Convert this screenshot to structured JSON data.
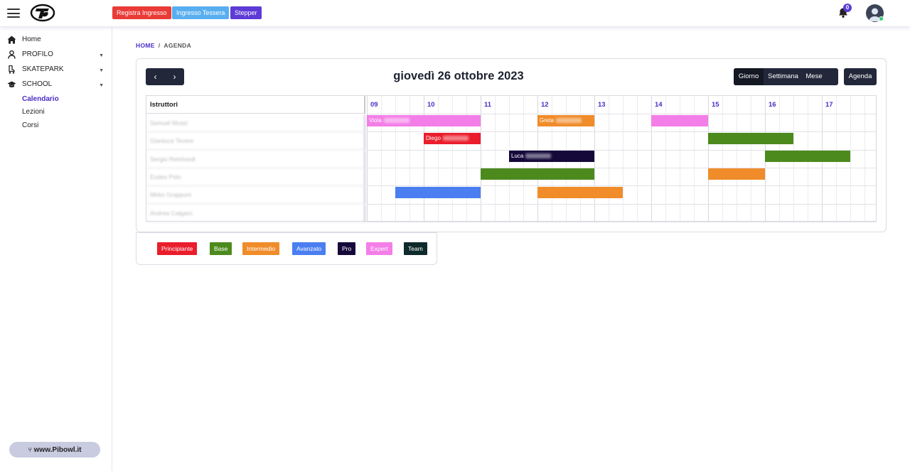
{
  "colors": {
    "accent": "#4b2cc7",
    "principiante": "#ea1d2c",
    "base": "#4c8a1e",
    "intermedio": "#f08c2a",
    "avanzato": "#4a7ef1",
    "pro": "#15093a",
    "expert": "#f47ee8",
    "team": "#0f2a2b",
    "registra_btn": "#ea3b36",
    "tessera_btn": "#59aef0",
    "stepper_btn": "#5c3bd6"
  },
  "topbar": {
    "menu_icon": "hamburger-icon",
    "logo": "pibowl-logo",
    "buttons": [
      "Registra Ingresso",
      "Ingresso Tessera",
      "Stepper"
    ],
    "notifications_count": "0"
  },
  "sidebar": {
    "items": [
      {
        "label": "Home",
        "icon": "home-icon"
      },
      {
        "label": "PROFILO",
        "icon": "user-icon"
      },
      {
        "label": "SKATEPARK",
        "icon": "skate-icon"
      },
      {
        "label": "SCHOOL",
        "icon": "graduation-cap-icon"
      }
    ],
    "school_sub": [
      "Calendario",
      "Lezioni",
      "Corsi"
    ],
    "site_link": "www.Pibowl.it"
  },
  "breadcrumb": {
    "home": "HOME",
    "sep": "/",
    "current": "AGENDA"
  },
  "calendar": {
    "title": "giovedì 26 ottobre 2023",
    "prev": "‹",
    "next": "›",
    "views": [
      "Giorno",
      "Settimana",
      "Mese"
    ],
    "active_view": "Giorno",
    "agenda_label": "Agenda",
    "resource_header": "Istruttori",
    "hours": [
      "09",
      "10",
      "11",
      "12",
      "13",
      "14",
      "15",
      "16",
      "17"
    ],
    "resources": [
      "Samuel Music",
      "Gianluca Tevere",
      "Sergio Reinhardt",
      "Eudes Polo",
      "Mirko Grapponi",
      "Andrea Calgaro"
    ],
    "events": [
      {
        "row": 0,
        "start": 9.0,
        "end": 11.0,
        "level": "expert",
        "label": "Viola"
      },
      {
        "row": 0,
        "start": 12.0,
        "end": 13.0,
        "level": "intermedio",
        "label": "Greta"
      },
      {
        "row": 0,
        "start": 14.0,
        "end": 15.0,
        "level": "expert",
        "label": ""
      },
      {
        "row": 1,
        "start": 10.0,
        "end": 11.0,
        "level": "principiante",
        "label": "Diego"
      },
      {
        "row": 1,
        "start": 15.0,
        "end": 16.5,
        "level": "base",
        "label": ""
      },
      {
        "row": 2,
        "start": 11.5,
        "end": 13.0,
        "level": "pro",
        "label": "Luca"
      },
      {
        "row": 2,
        "start": 16.0,
        "end": 17.5,
        "level": "base",
        "label": ""
      },
      {
        "row": 3,
        "start": 11.0,
        "end": 13.0,
        "level": "base",
        "label": ""
      },
      {
        "row": 3,
        "start": 15.0,
        "end": 16.0,
        "level": "intermedio",
        "label": ""
      },
      {
        "row": 4,
        "start": 9.5,
        "end": 11.0,
        "level": "avanzato",
        "label": ""
      },
      {
        "row": 4,
        "start": 12.0,
        "end": 13.5,
        "level": "intermedio",
        "label": ""
      }
    ]
  },
  "legend": [
    {
      "label": "Principiante",
      "level": "principiante"
    },
    {
      "label": "Base",
      "level": "base"
    },
    {
      "label": "Intermedio",
      "level": "intermedio"
    },
    {
      "label": "Avanzato",
      "level": "avanzato"
    },
    {
      "label": "Pro",
      "level": "pro"
    },
    {
      "label": "Expert",
      "level": "expert"
    },
    {
      "label": "Team",
      "level": "team"
    }
  ]
}
